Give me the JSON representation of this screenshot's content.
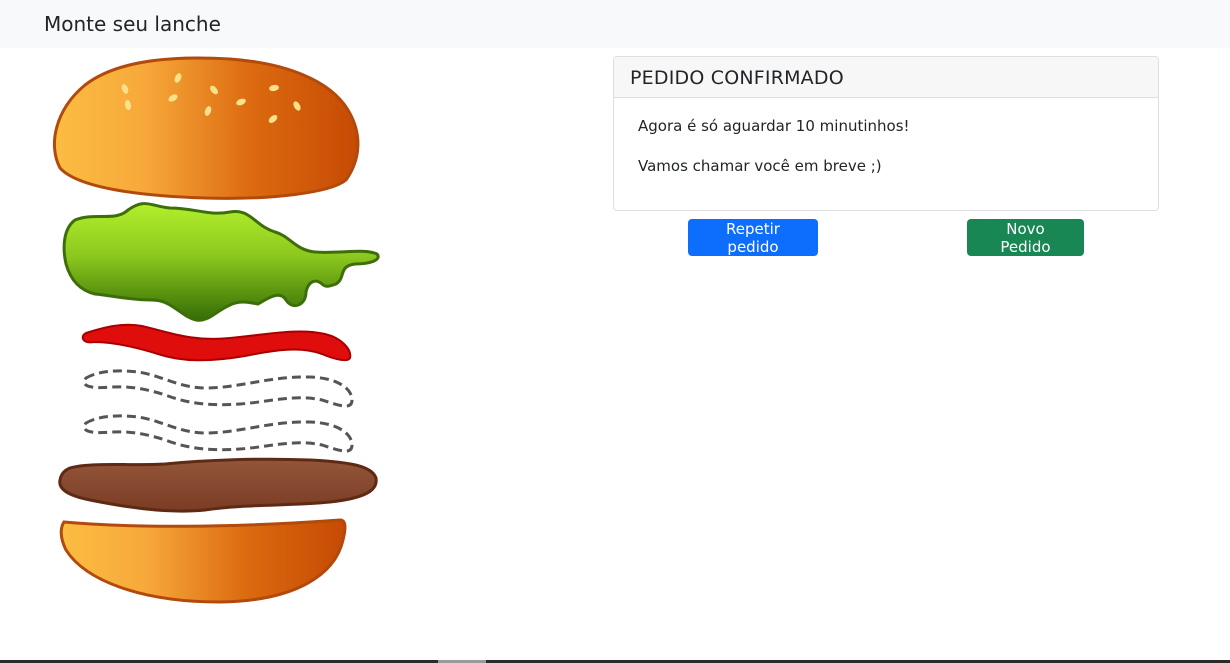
{
  "navbar": {
    "brand": "Monte seu lanche"
  },
  "burger": {
    "layers": [
      "bun-top",
      "lettuce",
      "ketchup",
      "empty-slot",
      "empty-slot",
      "patty",
      "bun-bottom"
    ],
    "colors": {
      "bun_light": "#fbbd43",
      "bun_dark": "#c64a04",
      "bun_stroke": "#b24a0c",
      "seed": "#f7e28a",
      "lettuce_light": "#a6e62a",
      "lettuce_dark": "#3a7406",
      "lettuce_stroke": "#3d6e0a",
      "ketchup": "#e00d0d",
      "ketchup_stroke": "#a80000",
      "placeholder_stroke": "#555555",
      "patty": "#8a4a30",
      "patty_stroke": "#5e2a14"
    }
  },
  "order_card": {
    "header": "PEDIDO CONFIRMADO",
    "line1": "Agora é só aguardar 10 minutinhos!",
    "line2": "Vamos chamar você em breve ;)"
  },
  "actions": {
    "repeat_label": "Repetir pedido",
    "new_label": "Novo Pedido",
    "repeat_color": "#0d6efd",
    "new_color": "#198754"
  }
}
